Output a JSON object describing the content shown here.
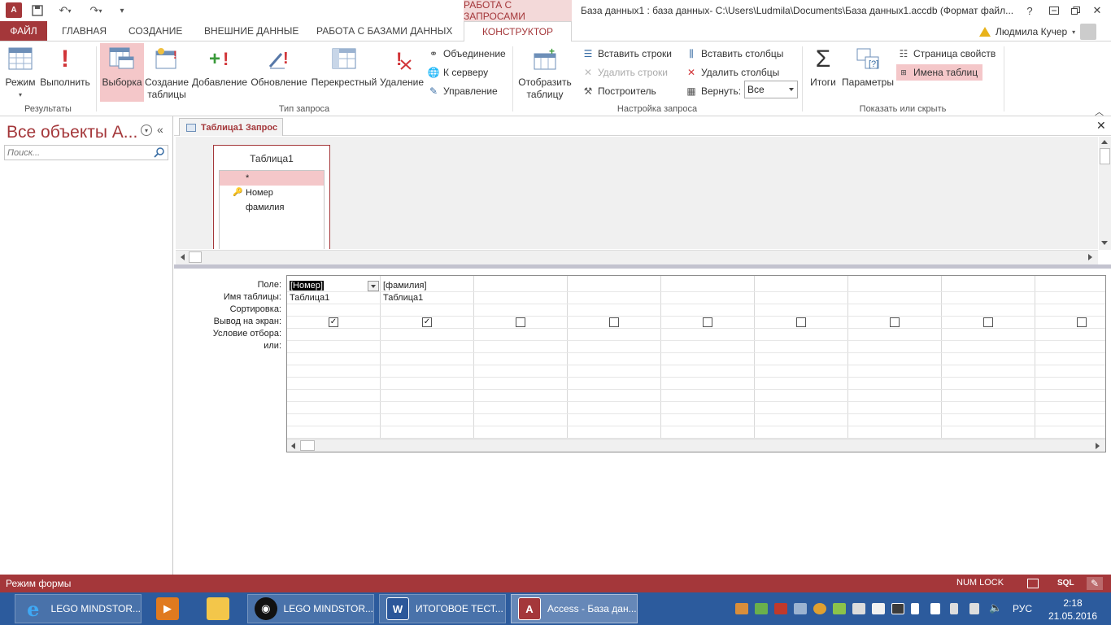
{
  "titlebar": {
    "app_icon": "A",
    "context_tab_header": "РАБОТА С ЗАПРОСАМИ",
    "window_title": "База данных1 : база данных- C:\\Users\\Ludmila\\Documents\\База данных1.accdb (Формат файл...",
    "icons": [
      "save-icon",
      "undo-icon",
      "redo-icon",
      "customize-qat-icon",
      "help-icon",
      "restore-icon",
      "minimize-icon",
      "close-icon"
    ]
  },
  "tabs": {
    "file": "ФАЙЛ",
    "home": "ГЛАВНАЯ",
    "create": "СОЗДАНИЕ",
    "external": "ВНЕШНИЕ ДАННЫЕ",
    "database_tools": "РАБОТА С БАЗАМИ ДАННЫХ",
    "designer": "КОНСТРУКТОР"
  },
  "user": {
    "name": "Людмила Кучер"
  },
  "ribbon": {
    "results": {
      "label": "Результаты",
      "view": "Режим",
      "run": "Выполнить"
    },
    "query_type": {
      "label": "Тип запроса",
      "select": "Выборка",
      "make_table_line1": "Создание",
      "make_table_line2": "таблицы",
      "append": "Добавление",
      "update": "Обновление",
      "crosstab": "Перекрестный",
      "delete": "Удаление",
      "union": "Объединение",
      "pass_through": "К серверу",
      "data_definition": "Управление"
    },
    "setup": {
      "label": "Настройка запроса",
      "show_table_line1": "Отобразить",
      "show_table_line2": "таблицу",
      "insert_rows": "Вставить строки",
      "delete_rows": "Удалить строки",
      "builder": "Построитель",
      "insert_columns": "Вставить столбцы",
      "delete_columns": "Удалить столбцы",
      "return_label": "Вернуть:",
      "return_value": "Все"
    },
    "show_hide": {
      "label": "Показать или скрыть",
      "totals": "Итоги",
      "parameters": "Параметры",
      "property_sheet": "Страница свойств",
      "table_names": "Имена таблиц"
    }
  },
  "nav": {
    "title": "Все объекты А...",
    "search_placeholder": "Поиск..."
  },
  "document": {
    "tab_label": "Таблица1 Запрос",
    "table": {
      "name": "Таблица1",
      "fields": [
        "*",
        "Номер",
        "фамилия"
      ]
    }
  },
  "qbe": {
    "row_labels": [
      "Поле:",
      "Имя таблицы:",
      "Сортировка:",
      "Вывод на экран:",
      "Условие отбора:",
      "или:"
    ],
    "columns": [
      {
        "field": "[Номер]",
        "table": "Таблица1",
        "show": true
      },
      {
        "field": "[фамилия]",
        "table": "Таблица1",
        "show": true
      },
      {
        "field": "",
        "table": "",
        "show": false
      },
      {
        "field": "",
        "table": "",
        "show": false
      },
      {
        "field": "",
        "table": "",
        "show": false
      },
      {
        "field": "",
        "table": "",
        "show": false
      },
      {
        "field": "",
        "table": "",
        "show": false
      },
      {
        "field": "",
        "table": "",
        "show": false
      },
      {
        "field": "",
        "table": "",
        "show": false
      }
    ]
  },
  "statusbar": {
    "mode": "Режим формы",
    "numlock": "NUM LOCK",
    "sql": "SQL"
  },
  "taskbar": {
    "items": [
      {
        "label": "LEGO MINDSTOR...",
        "icon": "ie-icon"
      },
      {
        "label": "",
        "icon": "media-icon"
      },
      {
        "label": "",
        "icon": "explorer-icon"
      },
      {
        "label": "LEGO MINDSTOR...",
        "icon": "lego-icon"
      },
      {
        "label": "ИТОГОВОЕ ТЕСТ...",
        "icon": "word-icon"
      },
      {
        "label": "Access - База дан...",
        "icon": "access-icon"
      }
    ],
    "language": "РУС",
    "time": "2:18",
    "date": "21.05.2016"
  },
  "colors": {
    "accent": "#a4373a",
    "accent_light": "#f4c7c9",
    "taskbar": "#2c5b9d"
  }
}
